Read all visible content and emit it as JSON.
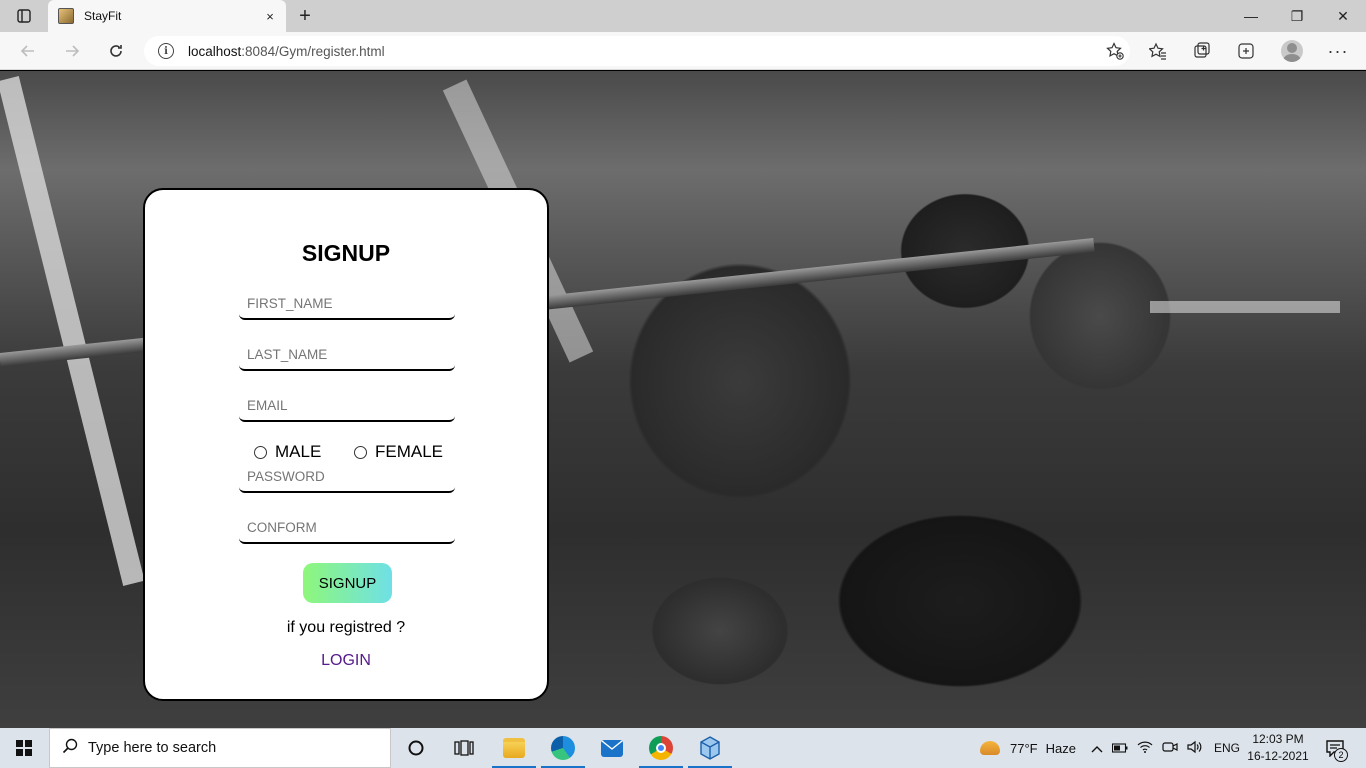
{
  "browser": {
    "tab_title": "StayFit",
    "tab_close_icon": "×",
    "new_tab_icon": "+",
    "url_host": "localhost",
    "url_path": ":8084/Gym/register.html",
    "window_controls": {
      "minimize": "—",
      "restore": "❐",
      "close": "✕"
    }
  },
  "signup_form": {
    "title": "SIGNUP",
    "first_name_placeholder": "FIRST_NAME",
    "last_name_placeholder": "LAST_NAME",
    "email_placeholder": "EMAIL",
    "gender_options": [
      "MALE",
      "FEMALE"
    ],
    "password_placeholder": "PASSWORD",
    "confirm_placeholder": "CONFORM",
    "submit_label": "SIGNUP",
    "prompt_text": "if you registred ?",
    "login_link": "LOGIN",
    "submit_gradient": [
      "#8ef77a",
      "#6fe0e6"
    ],
    "link_color": "#551a8b"
  },
  "taskbar": {
    "search_placeholder": "Type here to search",
    "weather_temp": "77°F",
    "weather_desc": "Haze",
    "language": "ENG",
    "time": "12:03 PM",
    "date": "16-12-2021",
    "notification_count": "2",
    "pinned_apps": [
      "task-view",
      "widgets",
      "file-explorer",
      "edge",
      "mail",
      "chrome",
      "3d-viewer"
    ]
  }
}
